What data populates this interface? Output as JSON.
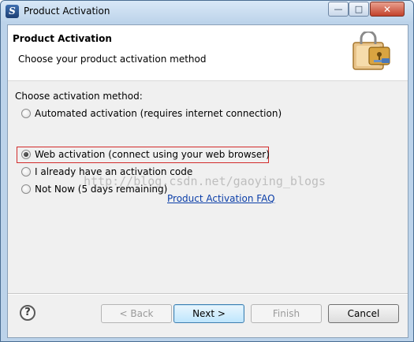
{
  "window": {
    "title": "Product Activation",
    "controls": {
      "minimize": "—",
      "maximize": "□",
      "close": "✕"
    }
  },
  "banner": {
    "title": "Product Activation",
    "description": "Choose your product activation method",
    "icon": "padlock-with-key-icon"
  },
  "content": {
    "section_label": "Choose activation method:",
    "options": [
      {
        "label": "Automated activation (requires internet connection)",
        "checked": false
      },
      {
        "label": "Web activation (connect using your web browser)",
        "checked": true,
        "highlighted": true
      },
      {
        "label": "I already have an activation code",
        "checked": false
      },
      {
        "label": "Not Now (5 days remaining)",
        "checked": false
      }
    ],
    "watermark": "http://blog.csdn.net/gaoying_blogs",
    "faq_link": "Product Activation FAQ"
  },
  "footer": {
    "help": "?",
    "back": "< Back",
    "next": "Next >",
    "finish": "Finish",
    "cancel": "Cancel"
  },
  "colors": {
    "highlight_border": "#d22b2b",
    "link": "#0b3ea8"
  }
}
